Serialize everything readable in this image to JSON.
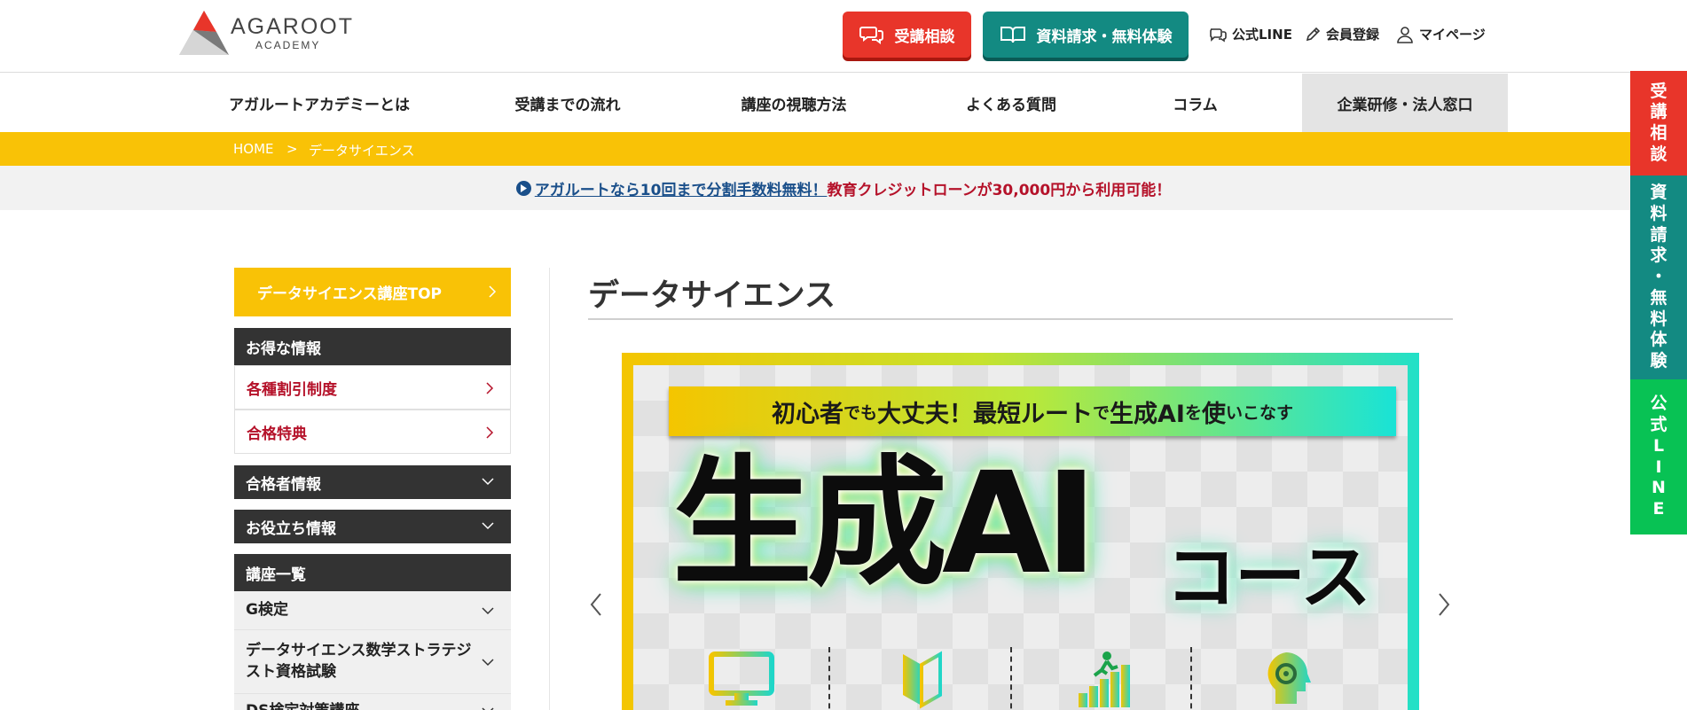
{
  "header": {
    "logo_text": "AGAROOT",
    "logo_sub": "ACADEMY",
    "consult_button": "受講相談",
    "request_button": "資料請求・無料体験",
    "line_link": "公式LINE",
    "register_link": "会員登録",
    "mypage_link": "マイページ",
    "colors": {
      "red": "#e8352a",
      "teal": "#138a82",
      "green": "#08c254",
      "yellow": "#f9c206"
    }
  },
  "nav": {
    "items": [
      "アガルートアカデミーとは",
      "受講までの流れ",
      "講座の視聴方法",
      "よくある質問",
      "コラム",
      "企業研修・法人窓口"
    ]
  },
  "breadcrumb": {
    "home": "HOME",
    "sep": ">",
    "current": "データサイエンス"
  },
  "notice": {
    "link_text": "アガルートなら10回まで分割手数料無料！",
    "rest_text": "教育クレジットローンが30,000円から利用可能！"
  },
  "sidebar": {
    "top_button": "データサイエンス講座TOP",
    "deals_heading": "お得な情報",
    "deals_items": [
      "各種割引制度",
      "合格特典"
    ],
    "passers_heading": "合格者情報",
    "useful_heading": "お役立ち情報",
    "courses_heading": "講座一覧",
    "course_items": [
      "G検定",
      "データサイエンス数学ストラテジスト資格試験",
      "DS検定対策講座"
    ]
  },
  "main": {
    "page_title": "データサイエンス",
    "banner": {
      "tagline_parts": [
        "初心者",
        "でも",
        "大丈夫！最短ルート",
        "で",
        "生成AI",
        "を",
        "使",
        "いこなす"
      ],
      "title": "生成AI",
      "title_sub": "コース"
    }
  },
  "side_tabs": {
    "consult": [
      "受",
      "講",
      "相",
      "談"
    ],
    "request": [
      "資",
      "料",
      "請",
      "求",
      "・",
      "無",
      "料",
      "体",
      "験"
    ],
    "line": [
      "公",
      "式",
      "L",
      "I",
      "N",
      "E"
    ]
  }
}
